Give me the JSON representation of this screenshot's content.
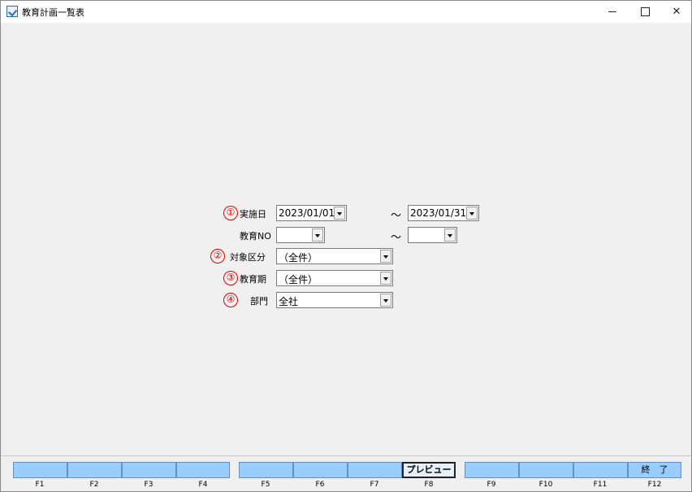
{
  "window": {
    "title": "教育計画一覧表"
  },
  "form": {
    "date_label": "実施日",
    "date_from": "2023/01/01",
    "date_to": "2023/01/31",
    "range_sep": "～",
    "edu_no_label": "教育NO",
    "edu_no_from": "",
    "edu_no_to": "",
    "target_label": "対象区分",
    "target_value": "（全件）",
    "period_label": "教育期",
    "period_value": "（全件）",
    "dept_label": "部門",
    "dept_value": "全社",
    "markers": [
      "①",
      "②",
      "③",
      "④"
    ]
  },
  "fkeys": [
    {
      "label": "",
      "key": "F1"
    },
    {
      "label": "",
      "key": "F2"
    },
    {
      "label": "",
      "key": "F3"
    },
    {
      "label": "",
      "key": "F4"
    },
    {
      "label": "",
      "key": "F5"
    },
    {
      "label": "",
      "key": "F6"
    },
    {
      "label": "",
      "key": "F7"
    },
    {
      "label": "プレビュー",
      "key": "F8"
    },
    {
      "label": "",
      "key": "F9"
    },
    {
      "label": "",
      "key": "F10"
    },
    {
      "label": "",
      "key": "F11"
    },
    {
      "label": "終　了",
      "key": "F12"
    }
  ],
  "colors": {
    "fkey_bg": "#99ccff",
    "marker": "#e00000"
  }
}
